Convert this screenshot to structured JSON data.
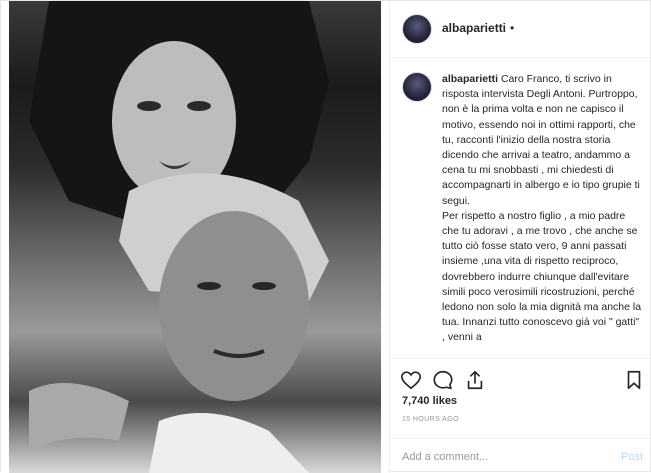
{
  "header": {
    "username": "albaparietti",
    "separator": "•"
  },
  "caption": {
    "username": "albaparietti",
    "paragraph1": " Caro Franco, ti scrivo in risposta intervista Degli Antoni. Purtroppo, non è la prima volta e non ne capisco il motivo, essendo noi in ottimi rapporti, che tu, racconti l'inizio della nostra storia dicendo che arrivai a teatro, andammo a cena tu mi snobbasti , mi chiedesti di accompagnarti in albergo e io tipo grupie ti segui.",
    "paragraph2": "Per rispetto a nostro figlio , a mio padre che tu adoravi , a me trovo , che anche se tutto ciò fosse stato vero, 9 anni passati insieme ,una vita di rispetto reciproco, dovrebbero indurre chiunque dall'evitare simili poco verosimili ricostruzioni, perché ledono non solo la mia dignità ma anche la tua. Innanzi tutto conoscevo già voi \" gatti\" , venni a"
  },
  "likes": "7,740 likes",
  "timestamp": "15 HOURS AGO",
  "comment_box": {
    "placeholder": "Add a comment...",
    "post_label": "Post"
  },
  "icons": [
    "heart-icon",
    "comment-icon",
    "share-icon",
    "bookmark-icon"
  ],
  "colors": {
    "post_button": "#b3dbff",
    "muted_text": "#999999",
    "text": "#262626"
  }
}
